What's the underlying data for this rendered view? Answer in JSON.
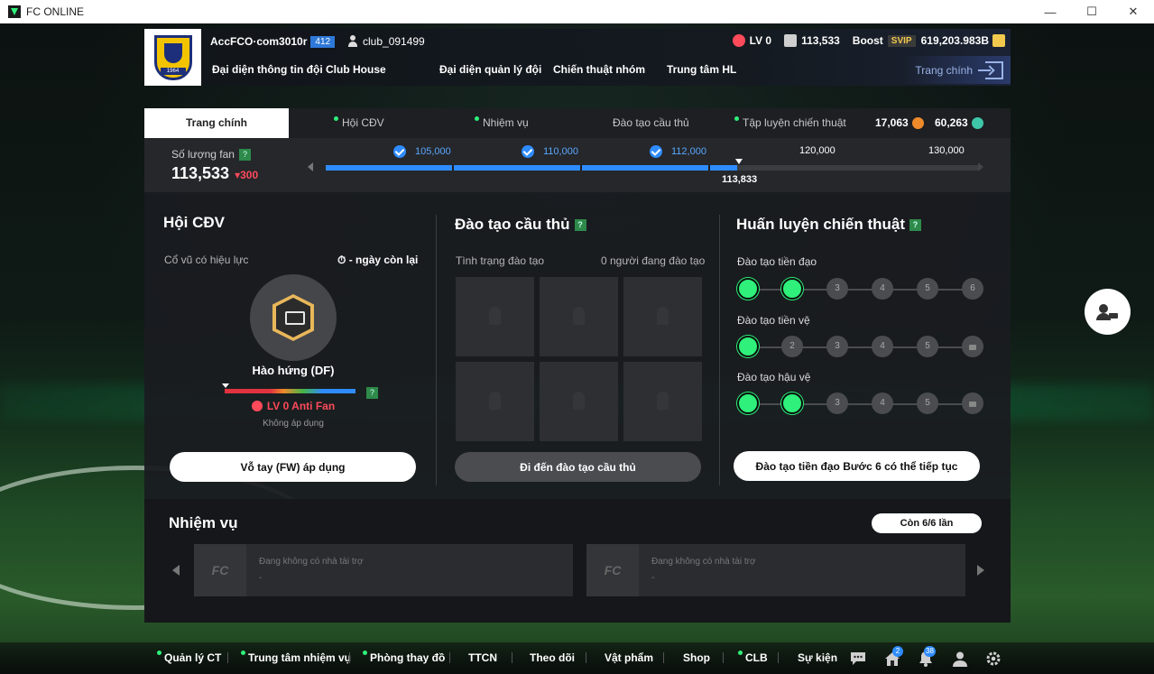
{
  "window": {
    "title": "FC ONLINE",
    "minimize": "—",
    "maximize": "☐",
    "close": "✕"
  },
  "header": {
    "account": "AccFCO·com3010r",
    "account_level": "412",
    "club": "club_091499",
    "crest_year": "1964",
    "lv": "LV 0",
    "points": "113,533",
    "boost_label": "Boost",
    "svip": "SVIP",
    "bp": "619,203.983B",
    "nav": [
      "Đại diện thông tin đội",
      "Club House",
      "Đại diện quản lý đội",
      "Chiến thuật nhóm",
      "Trung tâm HL"
    ],
    "home": "Trang chính"
  },
  "tabs": {
    "items": [
      "Trang chính",
      "Hội CĐV",
      "Nhiệm vụ",
      "Đào tạo cầu thủ",
      "Tập luyện chiến thuật"
    ],
    "currency1": "17,063",
    "currency2": "60,263"
  },
  "fans": {
    "label": "Số lượng fan",
    "count": "113,533",
    "delta": "300",
    "milestones": [
      "105,000",
      "110,000",
      "112,000",
      "120,000",
      "130,000"
    ],
    "current": "113,833",
    "progress_fraction": 0.63
  },
  "supporters": {
    "title": "Hội CĐV",
    "effect_label": "Cổ vũ có hiệu lực",
    "days_left": "- ngày còn lại",
    "mood": "Hào hứng (DF)",
    "anti": "LV 0 Anti Fan",
    "not_applied": "Không áp dụng",
    "button": "Vỗ tay (FW) áp dụng"
  },
  "training": {
    "title": "Đào tạo cầu thủ",
    "status_label": "Tình trạng đào tạo",
    "status_value": "0 người đang đào tạo",
    "button": "Đi đến đào tạo cầu thủ"
  },
  "tactics": {
    "title": "Huấn luyện chiến thuật",
    "rows": [
      {
        "label": "Đào tạo tiền đạo",
        "steps": [
          "",
          "",
          "3",
          "4",
          "5",
          "6"
        ]
      },
      {
        "label": "Đào tạo tiền vệ",
        "steps": [
          "",
          "2",
          "3",
          "4",
          "5",
          ""
        ]
      },
      {
        "label": "Đào tạo hậu vệ",
        "steps": [
          "",
          "",
          "3",
          "4",
          "5",
          ""
        ]
      }
    ],
    "button": "Đào tạo tiền đạo Bước 6 có thể tiếp tục"
  },
  "missions": {
    "title": "Nhiệm vụ",
    "remaining": "Còn 6/6 lần",
    "cards": [
      {
        "logo": "FC",
        "line1": "Đang không có nhà tài trợ",
        "line2": "-"
      },
      {
        "logo": "FC",
        "line1": "Đang không có nhà tài trợ",
        "line2": "-"
      }
    ]
  },
  "bottom_nav": [
    "Quản lý CT",
    "Trung tâm nhiệm vụ",
    "Phòng thay đồ",
    "TTCN",
    "Theo dõi",
    "Vật phẩm",
    "Shop",
    "CLB",
    "Sự kiện"
  ],
  "notifications": {
    "home": "2",
    "bell": "38"
  },
  "colors": {
    "accent_green": "#2ef07a",
    "progress_blue": "#2f8cff",
    "alert_red": "#ff4a5a"
  }
}
